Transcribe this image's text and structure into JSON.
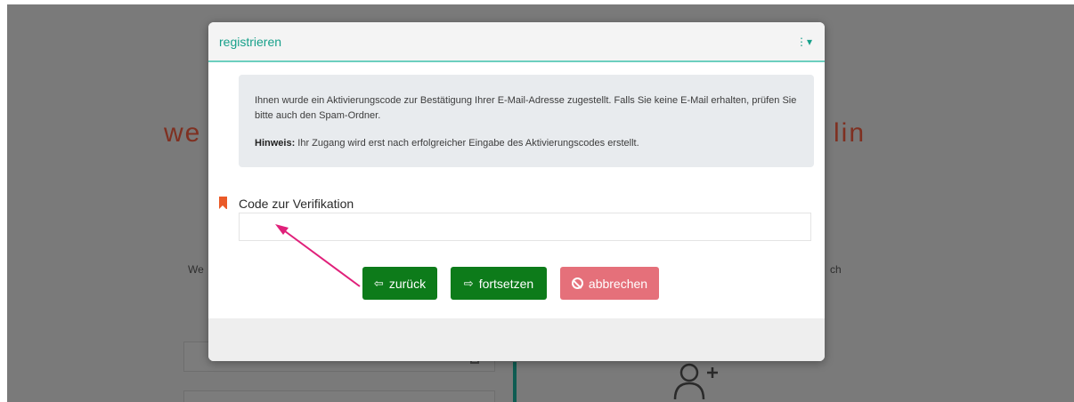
{
  "background": {
    "title_left": "we",
    "title_right": "lin",
    "text_left": "We",
    "text_right": "ch"
  },
  "modal": {
    "title": "registrieren",
    "menu_icon": "⋮▾",
    "info": {
      "text": "Ihnen wurde ein Aktivierungscode zur Bestätigung Ihrer E-Mail-Adresse zugestellt. Falls Sie keine E-Mail erhalten, prüfen Sie bitte auch den Spam-Ordner.",
      "hint_label": "Hinweis:",
      "hint_text": " Ihr Zugang wird erst nach erfolgreicher Eingabe des Aktivierungscodes erstellt."
    },
    "field": {
      "label": "Code zur Verifikation",
      "value": "",
      "placeholder": ""
    },
    "buttons": {
      "back_icon": "⇦",
      "back_label": "zurück",
      "next_icon": "⇨",
      "next_label": "fortsetzen",
      "cancel_label": "abbrechen"
    }
  },
  "colors": {
    "accent": "#17a08a",
    "button_green": "#0d7b1a",
    "button_cancel": "#e5707a",
    "marker": "#ea5a28",
    "annotation_arrow": "#e0207a"
  },
  "icons": {
    "marker": "bookmark-icon",
    "back": "arrow-left-icon",
    "next": "arrow-right-icon",
    "cancel": "ban-icon",
    "menu": "kebab-menu-icon"
  }
}
